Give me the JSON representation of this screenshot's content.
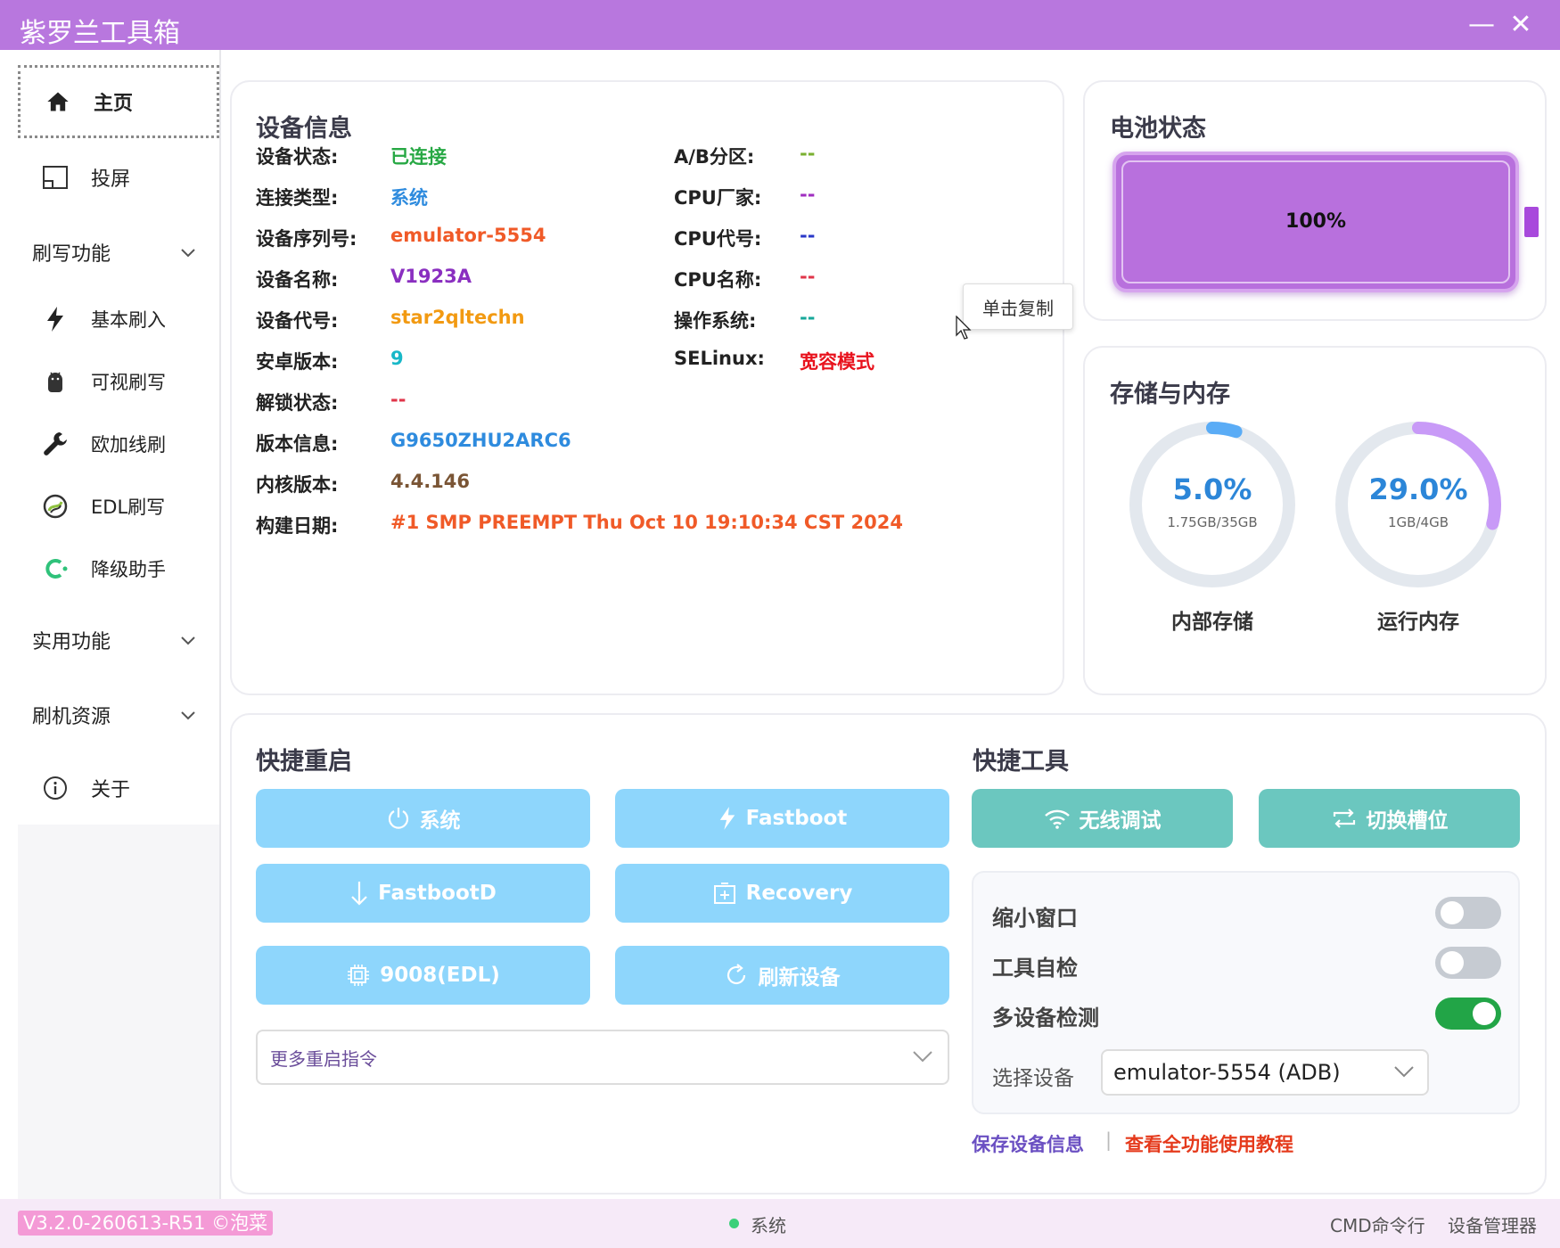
{
  "window": {
    "title": "紫罗兰工具箱",
    "minimize": "—",
    "close": "✕"
  },
  "sidebar": {
    "items": [
      {
        "label": "主页",
        "icon": "home-icon"
      },
      {
        "label": "投屏",
        "icon": "screen-cast-icon"
      }
    ],
    "groups": [
      {
        "label": "刷写功能",
        "sub": [
          {
            "label": "基本刷入",
            "icon": "lightning-icon"
          },
          {
            "label": "可视刷写",
            "icon": "android-icon"
          },
          {
            "label": "欧加线刷",
            "icon": "wrench-icon"
          },
          {
            "label": "EDL刷写",
            "icon": "edl-icon"
          },
          {
            "label": "降级助手",
            "icon": "downgrade-icon"
          }
        ]
      },
      {
        "label": "实用功能"
      },
      {
        "label": "刷机资源"
      }
    ],
    "about": {
      "label": "关于",
      "icon": "info-icon"
    }
  },
  "device_info": {
    "title": "设备信息",
    "left": [
      {
        "label": "设备状态:",
        "value": "已连接",
        "color": "#27a844"
      },
      {
        "label": "连接类型:",
        "value": "系统",
        "color": "#2e8bde"
      },
      {
        "label": "设备序列号:",
        "value": "emulator-5554",
        "color": "#f05a28"
      },
      {
        "label": "设备名称:",
        "value": "V1923A",
        "color": "#8a2fc0"
      },
      {
        "label": "设备代号:",
        "value": "star2qltechn",
        "color": "#f29a12"
      },
      {
        "label": "安卓版本:",
        "value": "9",
        "color": "#18b8c8"
      },
      {
        "label": "解锁状态:",
        "value": "--",
        "color": "#e0354a"
      },
      {
        "label": "版本信息:",
        "value": "G9650ZHU2ARC6",
        "color": "#2e8bde"
      },
      {
        "label": "内核版本:",
        "value": "4.4.146",
        "color": "#7a5535"
      },
      {
        "label": "构建日期:",
        "value": "#1 SMP PREEMPT Thu Oct 10 19:10:34 CST 2024",
        "color": "#f05a28"
      }
    ],
    "right": [
      {
        "label": "A/B分区:",
        "value": "--",
        "color": "#7ab030"
      },
      {
        "label": "CPU厂家:",
        "value": "--",
        "color": "#a02ec0"
      },
      {
        "label": "CPU代号:",
        "value": "--",
        "color": "#2a38c8"
      },
      {
        "label": "CPU名称:",
        "value": "--",
        "color": "#e0354a"
      },
      {
        "label": "操作系统:",
        "value": "--",
        "color": "#18a89a"
      },
      {
        "label": "SELinux:",
        "value": "宽容模式",
        "color": "#e8121d"
      }
    ],
    "tooltip": "单击复制"
  },
  "battery": {
    "title": "电池状态",
    "percent_label": "100%",
    "level": 1.0
  },
  "storage": {
    "title": "存储与内存",
    "rings": [
      {
        "pct_label": "5.0%",
        "fraction": 0.05,
        "sub": "1.75GB/35GB",
        "label": "内部存储",
        "color": "#5aacf6",
        "text_color": "#2c86d8"
      },
      {
        "pct_label": "29.0%",
        "fraction": 0.29,
        "sub": "1GB/4GB",
        "label": "运行内存",
        "color": "#c89af7",
        "text_color": "#2c86d8"
      }
    ]
  },
  "quick_reboot": {
    "title": "快捷重启",
    "buttons": [
      {
        "label": "系统",
        "icon": "power-icon"
      },
      {
        "label": "Fastboot",
        "icon": "lightning-icon"
      },
      {
        "label": "FastbootD",
        "icon": "arrow-down-icon"
      },
      {
        "label": "Recovery",
        "icon": "recovery-icon"
      },
      {
        "label": "9008(EDL)",
        "icon": "chip-icon"
      },
      {
        "label": "刷新设备",
        "icon": "refresh-icon"
      }
    ],
    "more_placeholder": "更多重启指令"
  },
  "quick_tools": {
    "title": "快捷工具",
    "buttons": [
      {
        "label": "无线调试",
        "icon": "wifi-icon"
      },
      {
        "label": "切换槽位",
        "icon": "swap-icon"
      }
    ],
    "toggles": [
      {
        "label": "缩小窗口",
        "on": false
      },
      {
        "label": "工具自检",
        "on": false
      },
      {
        "label": "多设备检测",
        "on": true
      }
    ],
    "device_select": {
      "label": "选择设备",
      "value": "emulator-5554 (ADB)"
    },
    "links": {
      "save": "保存设备信息",
      "divider": "|",
      "tutorial": "查看全功能使用教程"
    }
  },
  "statusbar": {
    "version": "V3.2.0-260613-R51 ©泡菜",
    "mode": "系统",
    "cmd": "CMD命令行",
    "device_manager": "设备管理器"
  }
}
